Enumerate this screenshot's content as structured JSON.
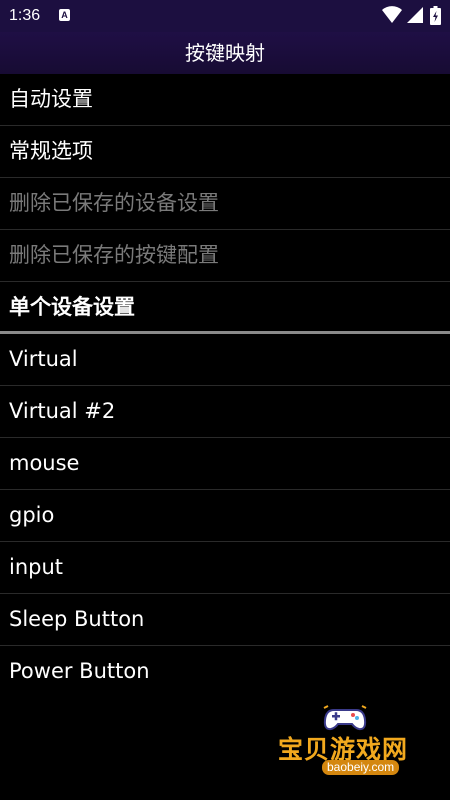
{
  "status_bar": {
    "time": "1:36",
    "notification_glyph": "A"
  },
  "header": {
    "title": "按键映射"
  },
  "menu": [
    {
      "label": "自动设置",
      "state": "enabled"
    },
    {
      "label": "常规选项",
      "state": "enabled"
    },
    {
      "label": "删除已保存的设备设置",
      "state": "disabled"
    },
    {
      "label": "删除已保存的按键配置",
      "state": "disabled"
    }
  ],
  "section": {
    "label": "单个设备设置"
  },
  "devices": [
    {
      "label": "Virtual"
    },
    {
      "label": "Virtual #2"
    },
    {
      "label": "mouse"
    },
    {
      "label": "gpio"
    },
    {
      "label": "input"
    },
    {
      "label": "Sleep Button"
    },
    {
      "label": "Power Button"
    }
  ],
  "watermark": {
    "brand": "宝贝游戏网",
    "domain": "baobeiy.com"
  },
  "colors": {
    "status_bar_bg": "#1c0f40",
    "header_bg": "#1f0f45",
    "list_bg": "#000000",
    "text_primary": "#ffffff",
    "text_disabled": "#7a7a7a",
    "watermark_orange": "#f2a91e"
  },
  "icons": {
    "wifi": "wifi-icon",
    "signal": "signal-icon",
    "battery": "battery-icon",
    "notification": "notification-a-icon"
  }
}
